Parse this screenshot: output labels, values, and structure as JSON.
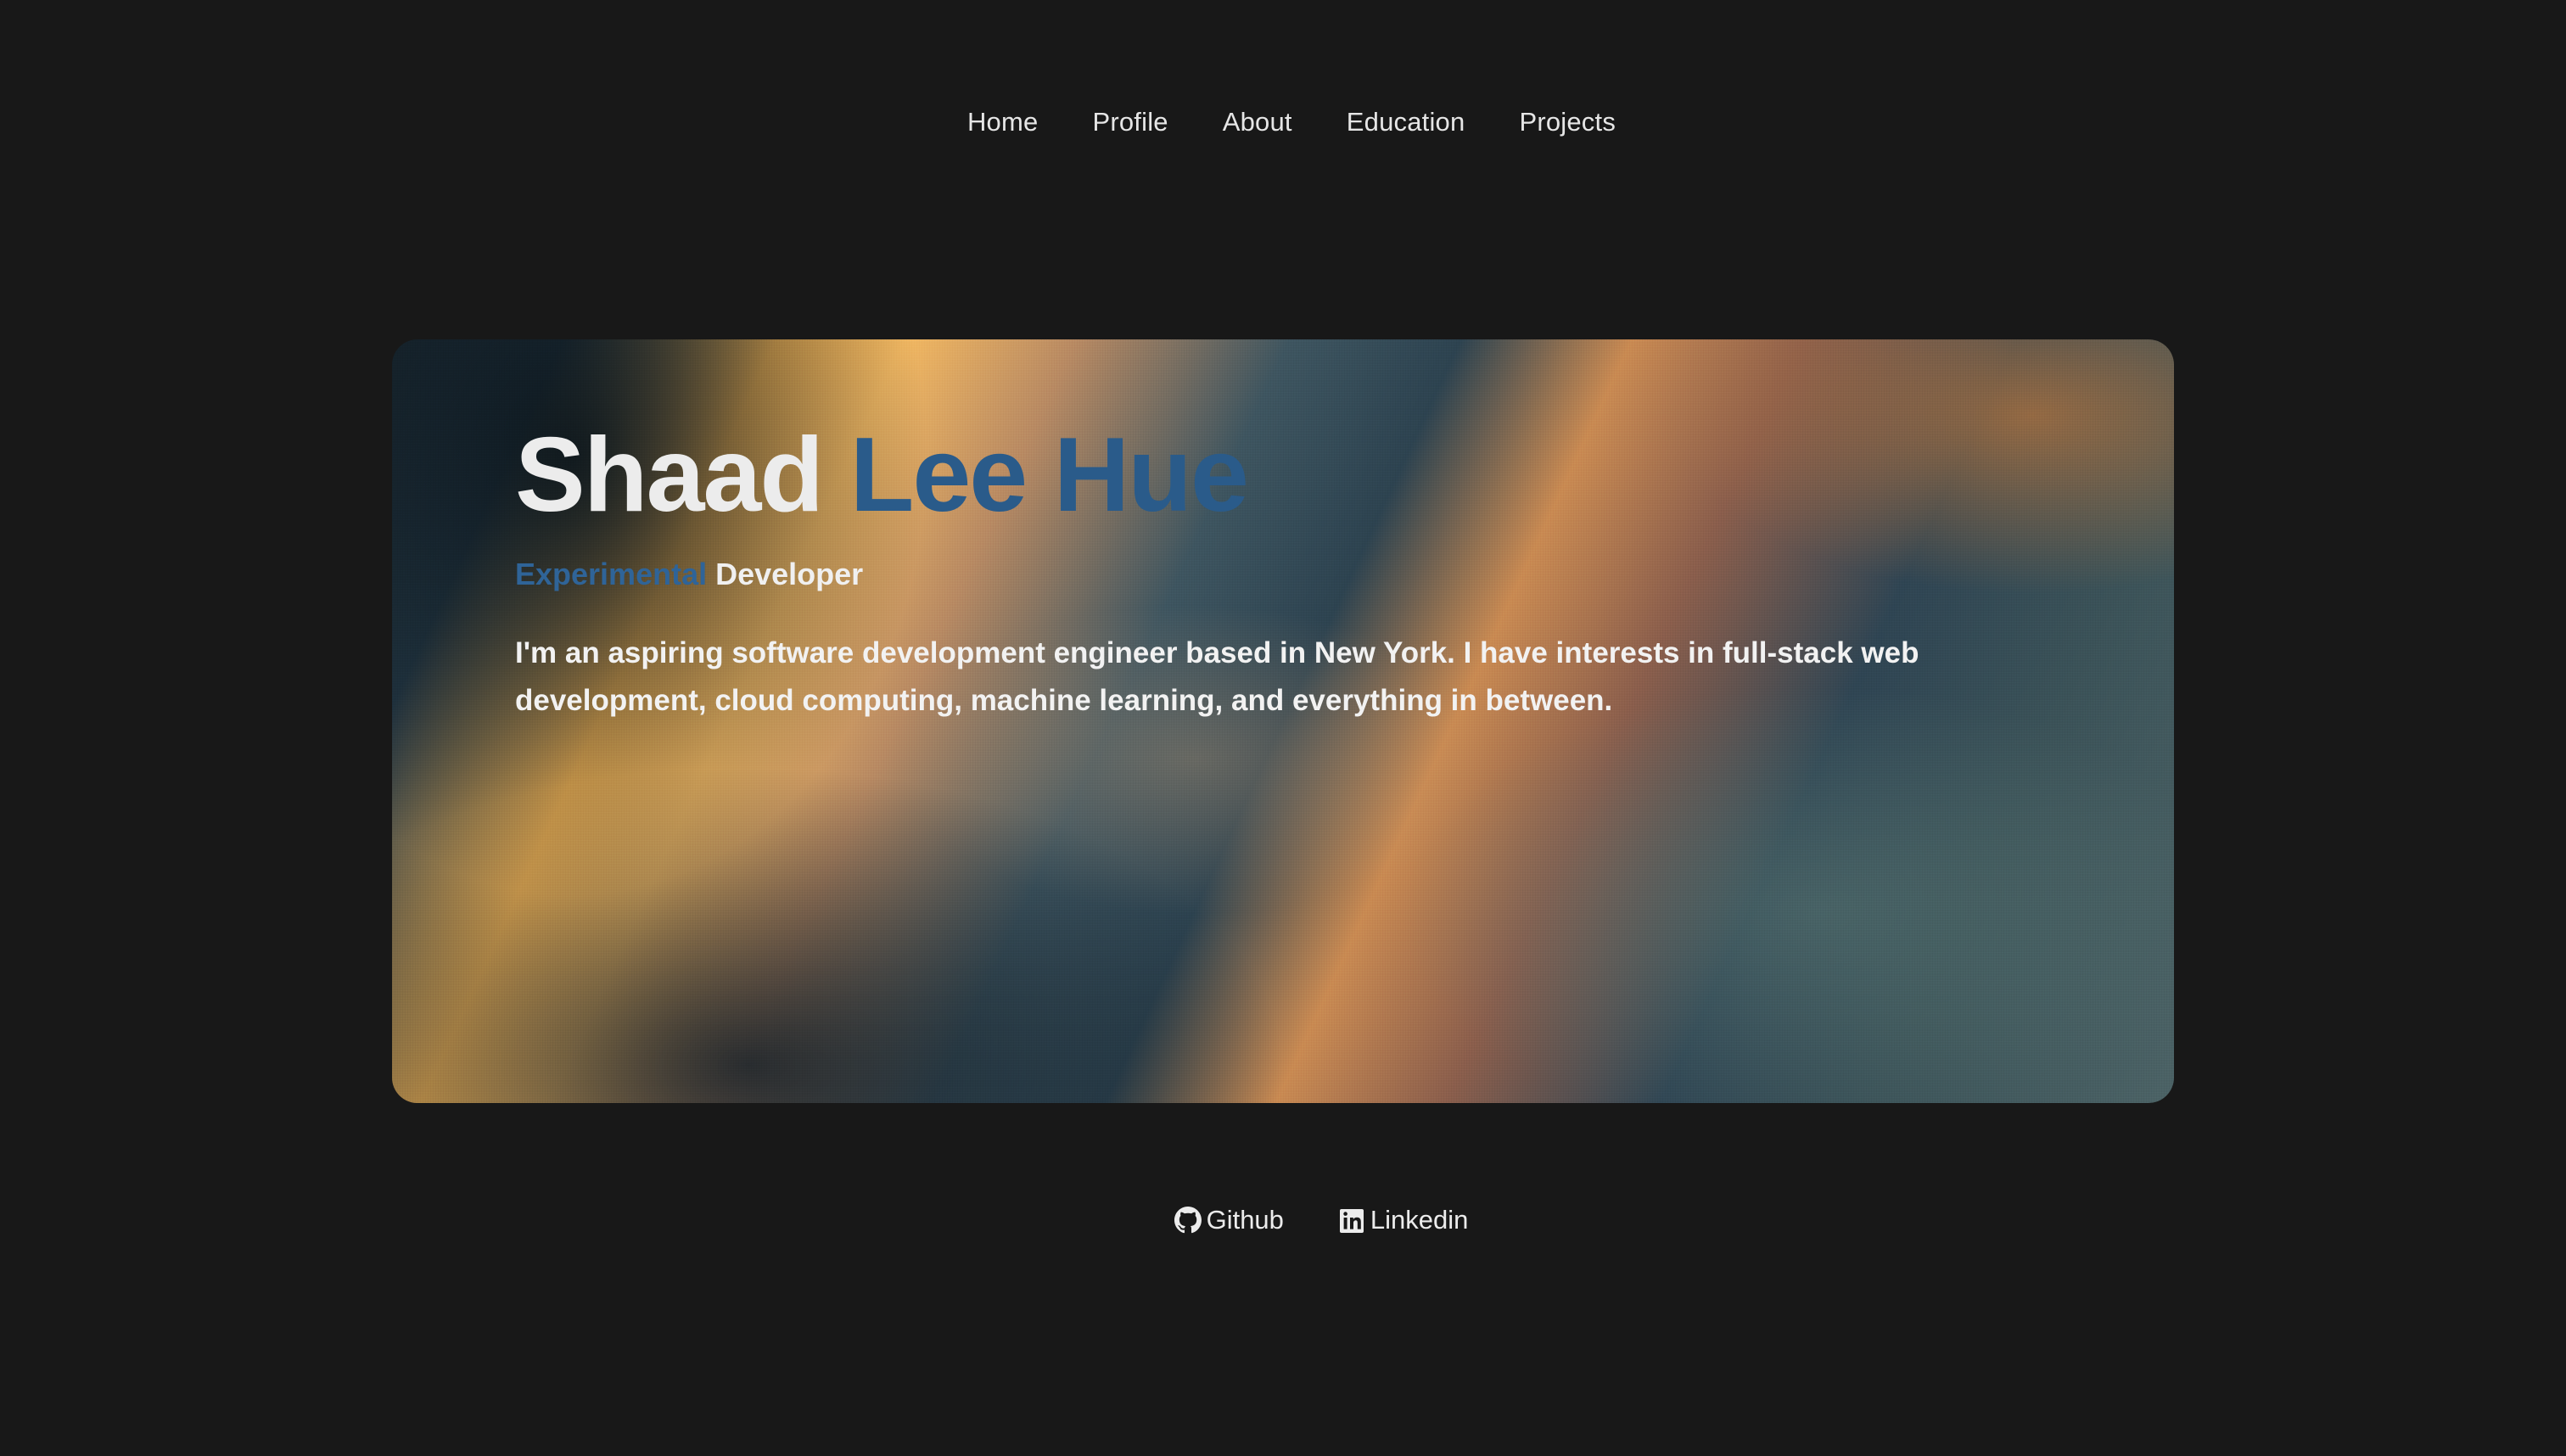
{
  "nav": {
    "items": [
      {
        "label": "Home"
      },
      {
        "label": "Profile"
      },
      {
        "label": "About"
      },
      {
        "label": "Education"
      },
      {
        "label": "Projects"
      }
    ]
  },
  "hero": {
    "name_first": "Shaad ",
    "name_last": "Lee Hue",
    "role_accent": "Experimental",
    "role_plain": " Developer",
    "bio": "I'm an aspiring software development engineer based in New York. I have interests in full-stack web development, cloud computing, machine learning, and everything in between."
  },
  "social": {
    "github_label": "Github",
    "github_icon": "github-icon",
    "linkedin_label": "Linkedin",
    "linkedin_icon": "linkedin-icon"
  },
  "colors": {
    "background": "#181818",
    "accent_blue": "#2a5b8a",
    "text": "#ececec"
  }
}
